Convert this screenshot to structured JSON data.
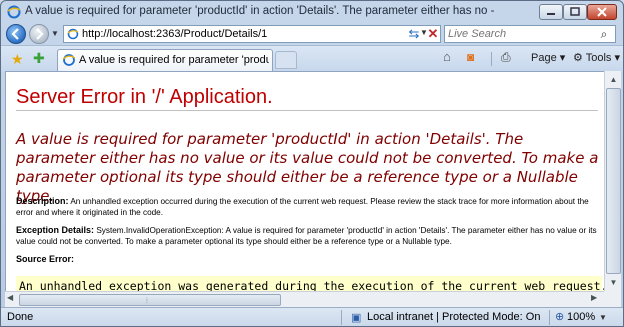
{
  "window": {
    "title": "A value is required for parameter 'productId' in action 'Details'. The parameter either has no  - Windows Internet Explorer",
    "icon": "ie-icon",
    "controls": [
      "minimize-icon",
      "maximize-icon",
      "close-icon"
    ]
  },
  "address_bar": {
    "url": "http://localhost:2363/Product/Details/1",
    "search_placeholder": "Live Search"
  },
  "tabs": [
    {
      "label": "A value is required for parameter 'productId' in a..."
    }
  ],
  "commands": {
    "page": "Page",
    "tools": "Tools"
  },
  "page": {
    "heading": "Server Error in '/' Application.",
    "error_message": "A value is required for parameter 'productId' in action 'Details'. The parameter either has no value or its value could not be converted. To make a parameter optional its type should either be a reference type or a Nullable type.",
    "description_label": "Description:",
    "description_text": "An unhandled exception occurred during the execution of the current web request. Please review the stack trace for more information about the error and where it originated in the code.",
    "exception_label": "Exception Details:",
    "exception_text": "System.InvalidOperationException: A value is required for parameter 'productId' in action 'Details'. The parameter either has no value or its value could not be converted. To make a parameter optional its type should either be a reference type or a Nullable type.",
    "source_error_label": "Source Error:",
    "code_line": "An unhandled exception was generated during the execution of the current web request. Information"
  },
  "status_bar": {
    "status": "Done",
    "zone": "Local intranet | Protected Mode: On",
    "zoom": "100%"
  }
}
